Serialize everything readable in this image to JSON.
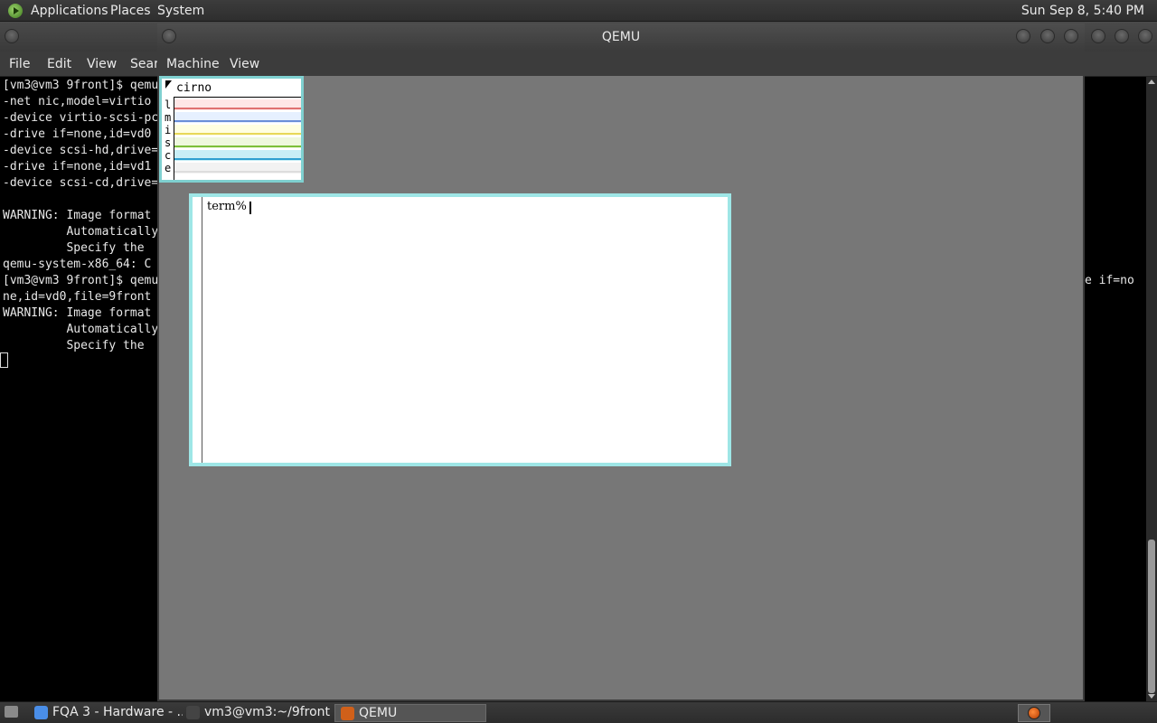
{
  "top_panel": {
    "menus": [
      "Applications",
      "Places",
      "System"
    ],
    "clock": "Sun Sep  8, 5:40 PM"
  },
  "terminal": {
    "menus": [
      "File",
      "Edit",
      "View",
      "Searc"
    ],
    "lines": [
      "[vm3@vm3 9front]$ qemu",
      "-net nic,model=virtio",
      "-device virtio-scsi-pc",
      "-drive if=none,id=vd0",
      "-device scsi-hd,drive=",
      "-drive if=none,id=vd1",
      "-device scsi-cd,drive=",
      "",
      "WARNING: Image format",
      "         Automatically",
      "         Specify the",
      "qemu-system-x86_64: C",
      "[vm3@vm3 9front]$ qemu",
      "ne,id=vd0,file=9front",
      "WARNING: Image format",
      "         Automatically",
      "         Specify the"
    ],
    "right_fragment": "e if=no"
  },
  "qemu": {
    "title": "QEMU",
    "menus": [
      "Machine",
      "View"
    ],
    "stats": {
      "host": "cirno",
      "rows": [
        {
          "label": "l",
          "bg": "#ffe6e6",
          "line": "#e07070"
        },
        {
          "label": "m",
          "bg": "#e6f0ff",
          "line": "#6a8fd8"
        },
        {
          "label": "i",
          "bg": "#ffffe0",
          "line": "#e8d85a"
        },
        {
          "label": "s",
          "bg": "#eef8dd",
          "line": "#7cbf3a"
        },
        {
          "label": "c",
          "bg": "#c8eef6",
          "line": "#2f9fd0"
        },
        {
          "label": "e",
          "bg": "#f2f2f2",
          "line": "#dddddd"
        }
      ]
    },
    "term_prompt": "term%"
  },
  "taskbar": {
    "tasks": [
      {
        "label": "FQA 3 - Hardware - ...",
        "icon_color": "#4a8ee8"
      },
      {
        "label": "vm3@vm3:~/9front",
        "icon_color": "#444444"
      },
      {
        "label": "QEMU",
        "icon_color": "#d0601a"
      }
    ]
  }
}
